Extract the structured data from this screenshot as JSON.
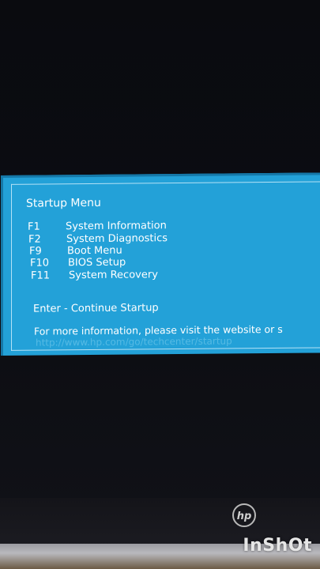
{
  "menu": {
    "title": "Startup Menu",
    "options": [
      {
        "key": "F1",
        "label": "System Information"
      },
      {
        "key": "F2",
        "label": "System Diagnostics"
      },
      {
        "key": "F9",
        "label": "Boot Menu"
      },
      {
        "key": "F10",
        "label": "BIOS Setup"
      },
      {
        "key": "F11",
        "label": "System Recovery"
      }
    ],
    "enter": "Enter - Continue Startup",
    "info": "For more information, please visit the website or s",
    "url": "http://www.hp.com/go/techcenter/startup"
  },
  "device": {
    "logo": "hp"
  },
  "overlay": {
    "watermark": "InShOt"
  },
  "colors": {
    "panel": "#23a1d8",
    "text": "#ffffff"
  }
}
